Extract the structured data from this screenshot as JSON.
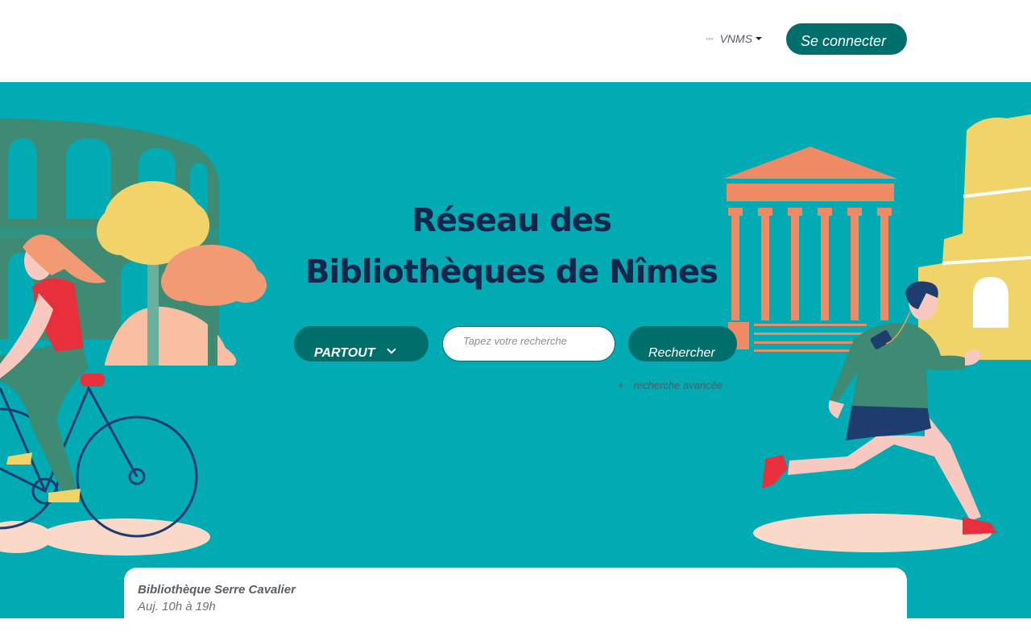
{
  "header": {
    "network_menu": {
      "icon": "dots-icon",
      "label": "VNMS"
    },
    "login_label": "Se connecter"
  },
  "hero": {
    "title_line1": "Réseau des",
    "title_line2": "Bibliothèques de Nîmes",
    "scope_selector": {
      "label": "PARTOUT",
      "icon": "chevron-down-icon"
    },
    "search": {
      "placeholder": "Tapez votre recherche",
      "value": ""
    },
    "search_button_label": "Rechercher",
    "advanced_search": {
      "icon": "plus-icon",
      "label": "recherche avancée"
    }
  },
  "library_card": {
    "name": "Bibliothèque Serre Cavalier",
    "hours": "Auj. 10h à 19h"
  },
  "colors": {
    "accent": "#006e6a",
    "hero_background": "#00abb3",
    "title": "#15264a",
    "temple": "#f08a64",
    "ruin": "#f0d46a",
    "aqueduct": "#3f8a72"
  }
}
